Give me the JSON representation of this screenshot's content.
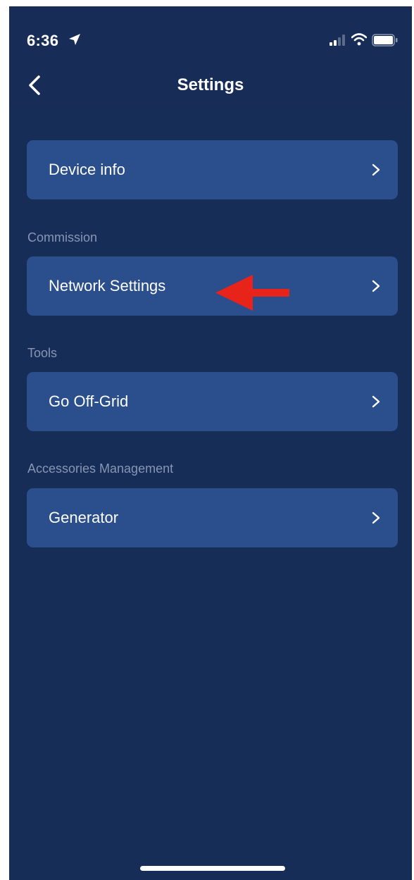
{
  "status_bar": {
    "time": "6:36",
    "location_icon": "location-arrow-icon",
    "signal_icon": "cellular-signal-icon",
    "wifi_icon": "wifi-icon",
    "battery_icon": "battery-icon"
  },
  "nav": {
    "title": "Settings",
    "back_icon": "chevron-left-icon"
  },
  "rows": {
    "device_info": {
      "label": "Device info"
    },
    "network_settings": {
      "label": "Network Settings"
    },
    "go_off_grid": {
      "label": "Go Off-Grid"
    },
    "generator": {
      "label": "Generator"
    }
  },
  "sections": {
    "commission": "Commission",
    "tools": "Tools",
    "accessories": "Accessories Management"
  },
  "annotation": {
    "arrow_icon": "red-arrow-left-icon",
    "color": "#e8231a"
  },
  "colors": {
    "background": "#162d58",
    "card": "#2b4e8c",
    "section_text": "#8796b3",
    "text": "#ffffff"
  }
}
